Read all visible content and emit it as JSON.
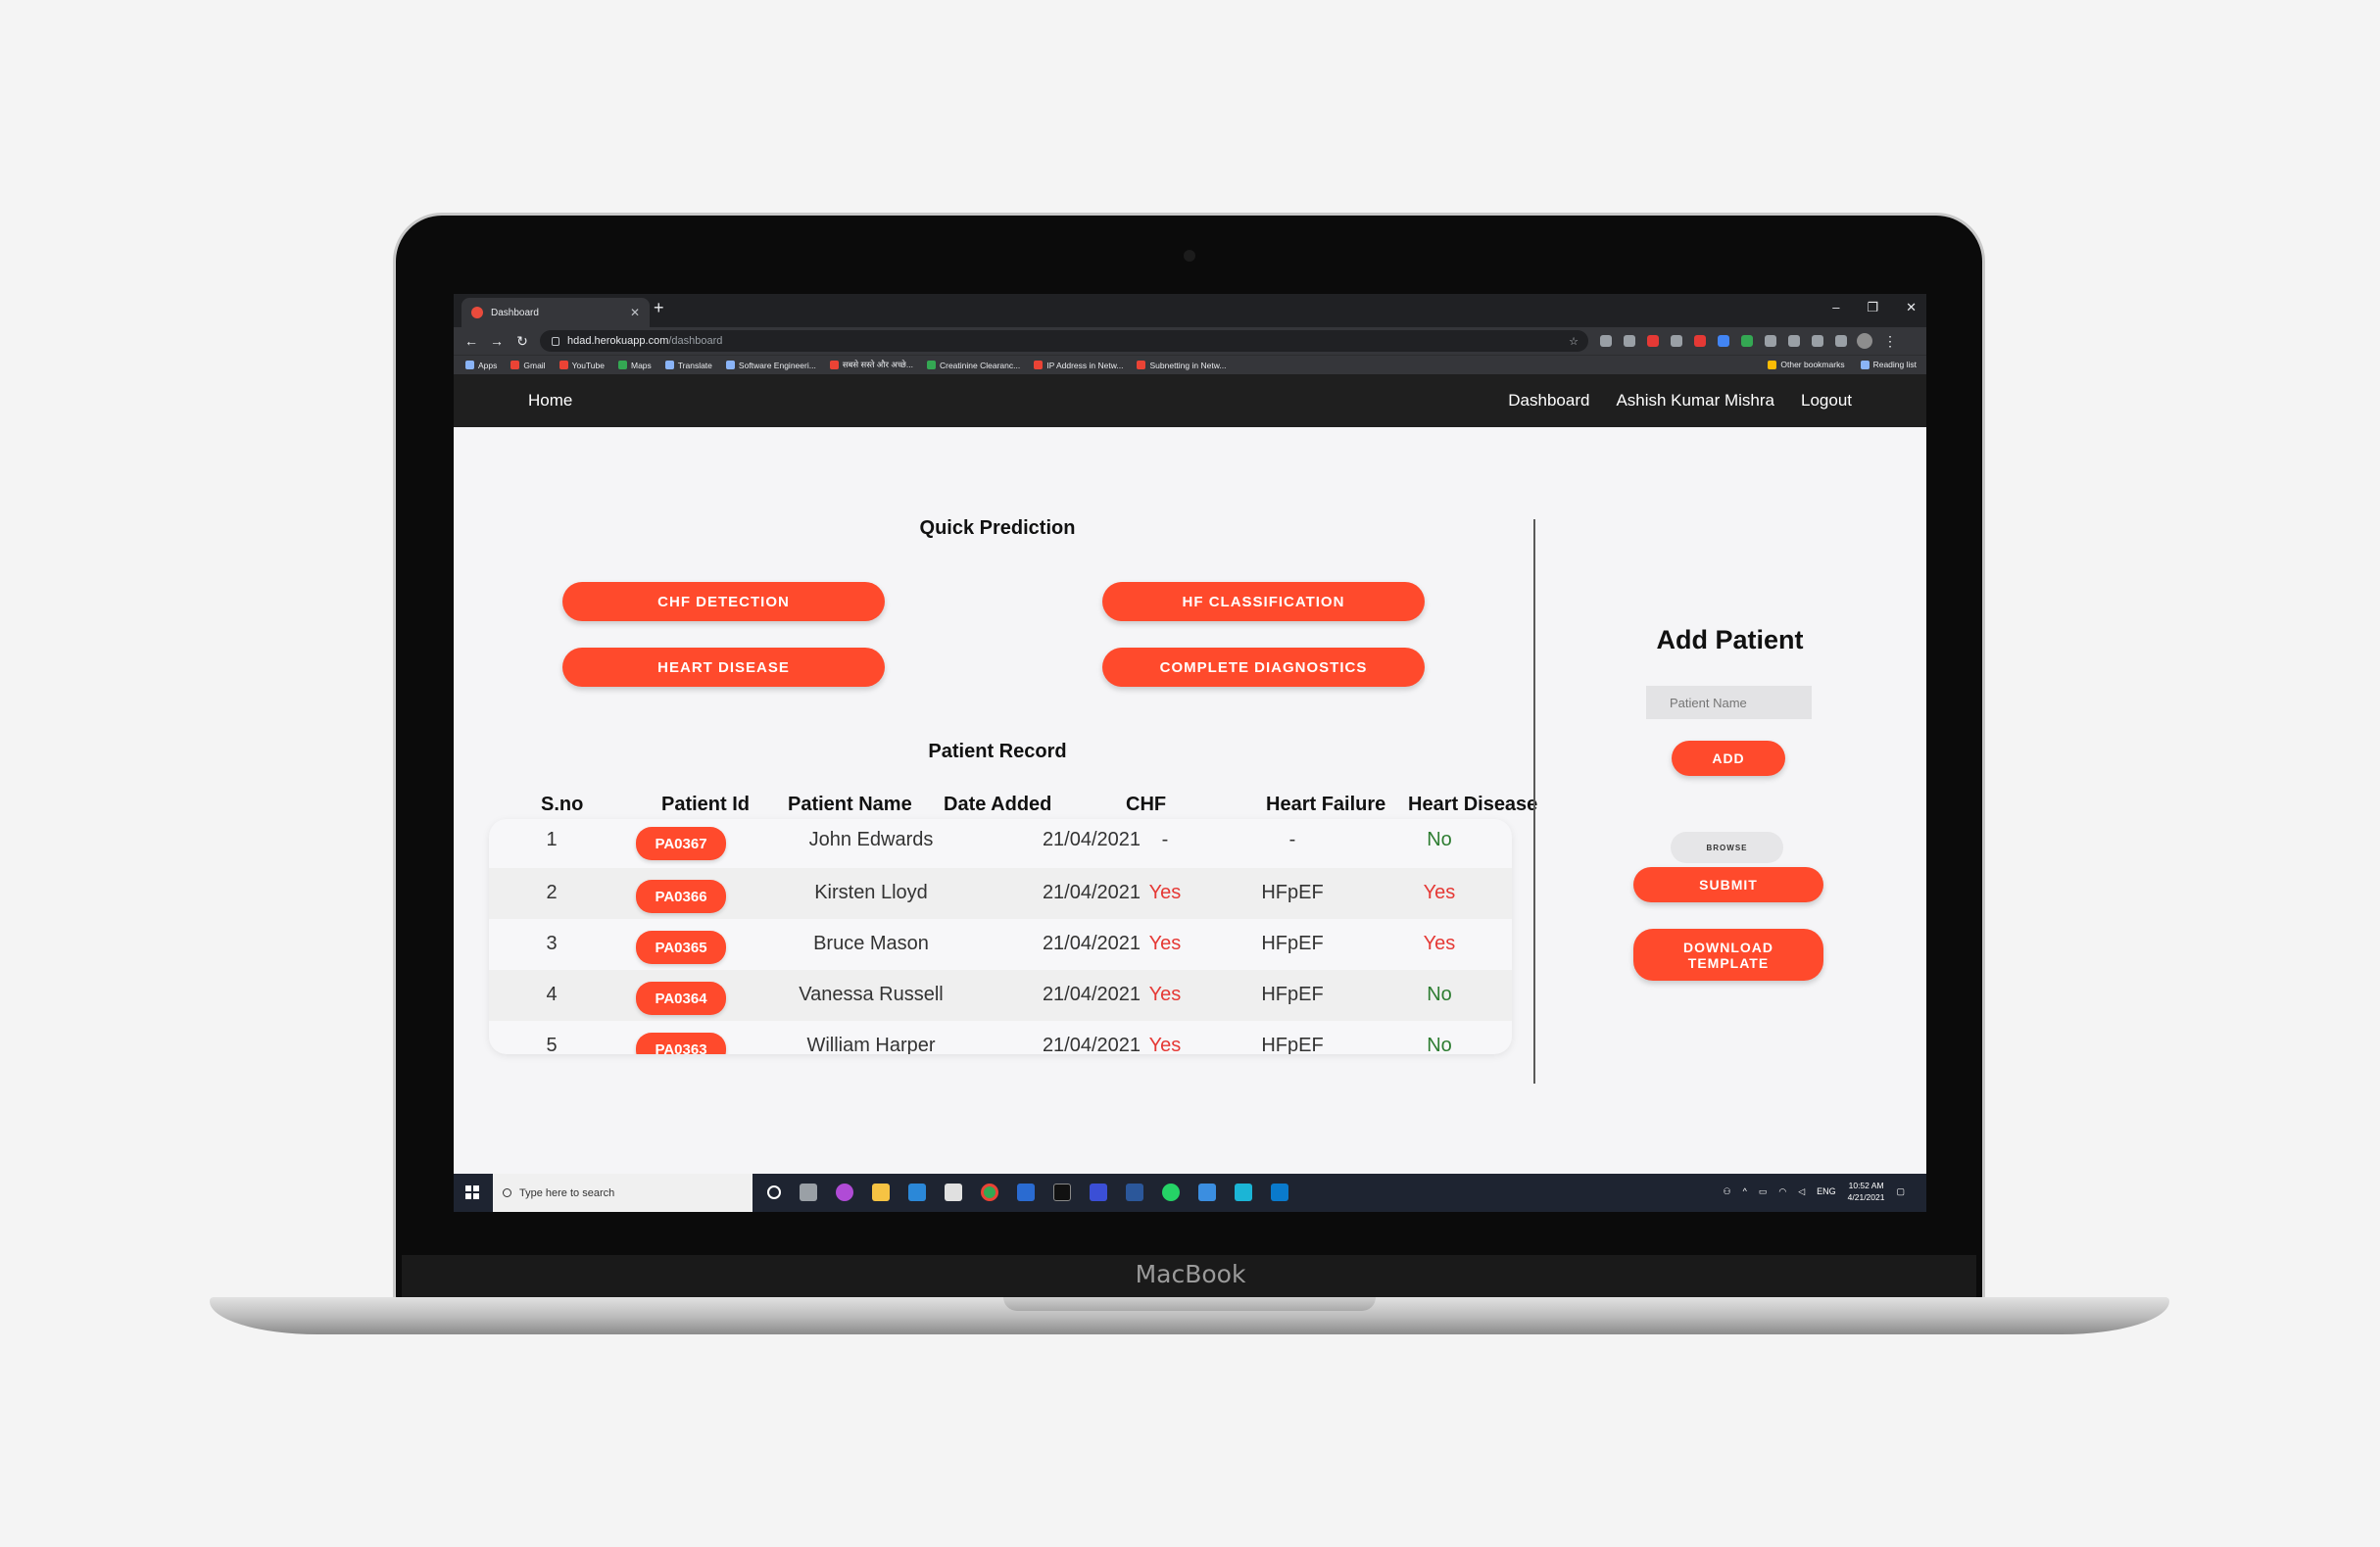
{
  "device": {
    "brand": "MacBook"
  },
  "browser": {
    "tab_title": "Dashboard",
    "new_tab": "+",
    "window_controls": [
      "–",
      "❐",
      "✕"
    ],
    "url_host": "hdad.herokuapp.com",
    "url_path": "/dashboard",
    "bookmarks": [
      "Apps",
      "Gmail",
      "YouTube",
      "Maps",
      "Translate",
      "Software Engineeri...",
      "सबसे सस्ते और अच्छे...",
      "Creatinine Clearanc...",
      "IP Address in Netw...",
      "Subnetting in Netw..."
    ],
    "bookmarks_right": [
      "Other bookmarks",
      "Reading list"
    ]
  },
  "navbar": {
    "home": "Home",
    "dashboard": "Dashboard",
    "user": "Ashish Kumar Mishra",
    "logout": "Logout"
  },
  "quick_prediction": {
    "title": "Quick Prediction",
    "buttons": [
      "CHF DETECTION",
      "HF CLASSIFICATION",
      "HEART DISEASE",
      "COMPLETE DIAGNOSTICS"
    ]
  },
  "patient_record": {
    "title": "Patient Record",
    "columns": [
      "S.no",
      "Patient Id",
      "Patient Name",
      "Date Added",
      "CHF",
      "Heart Failure",
      "Heart Disease"
    ],
    "rows": [
      {
        "sno": "1",
        "id": "PA0367",
        "name": "John Edwards",
        "date": "21/04/2021",
        "chf": "-",
        "hf": "-",
        "hd": "No"
      },
      {
        "sno": "2",
        "id": "PA0366",
        "name": "Kirsten Lloyd",
        "date": "21/04/2021",
        "chf": "Yes",
        "hf": "HFpEF",
        "hd": "Yes"
      },
      {
        "sno": "3",
        "id": "PA0365",
        "name": "Bruce Mason",
        "date": "21/04/2021",
        "chf": "Yes",
        "hf": "HFpEF",
        "hd": "Yes"
      },
      {
        "sno": "4",
        "id": "PA0364",
        "name": "Vanessa Russell",
        "date": "21/04/2021",
        "chf": "Yes",
        "hf": "HFpEF",
        "hd": "No"
      },
      {
        "sno": "5",
        "id": "PA0363",
        "name": "William Harper",
        "date": "21/04/2021",
        "chf": "Yes",
        "hf": "HFpEF",
        "hd": "No"
      }
    ]
  },
  "add_patient": {
    "title": "Add Patient",
    "placeholder": "Patient Name",
    "add": "ADD",
    "browse": "BROWSE",
    "submit": "SUBMIT",
    "download": "DOWNLOAD TEMPLATE"
  },
  "taskbar": {
    "search_placeholder": "Type here to search",
    "lang": "ENG",
    "time": "10:52 AM",
    "date": "4/21/2021"
  },
  "colors": {
    "accent": "#ff4a2c",
    "yes": "#e53935",
    "no": "#2e7d32",
    "navbar": "#1f1f1f"
  }
}
